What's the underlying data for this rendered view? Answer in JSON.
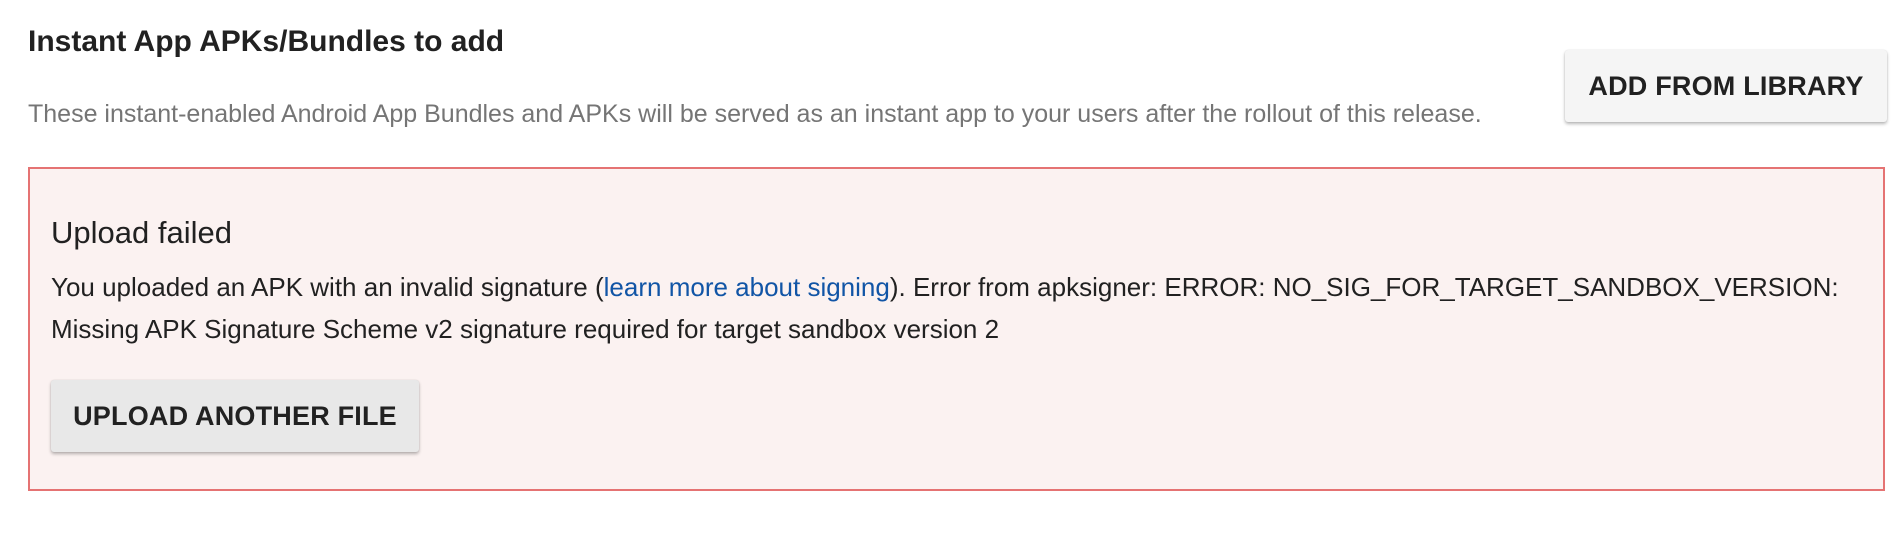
{
  "section": {
    "title": "Instant App APKs/Bundles to add",
    "description": "These instant-enabled Android App Bundles and APKs will be served as an instant app to your users after the rollout of this release."
  },
  "toolbar": {
    "add_from_library_label": "ADD FROM LIBRARY"
  },
  "error": {
    "title": "Upload failed",
    "message_prefix": "You uploaded an APK with an invalid signature (",
    "link_text": "learn more about signing",
    "message_suffix": "). Error from apksigner: ERROR: NO_SIG_FOR_TARGET_SANDBOX_VERSION: Missing APK Signature Scheme v2 signature required for target sandbox version 2",
    "upload_button_label": "UPLOAD ANOTHER FILE"
  },
  "colors": {
    "error_border": "#e57373",
    "error_background": "#fbf2f1",
    "link": "#1155a6"
  }
}
